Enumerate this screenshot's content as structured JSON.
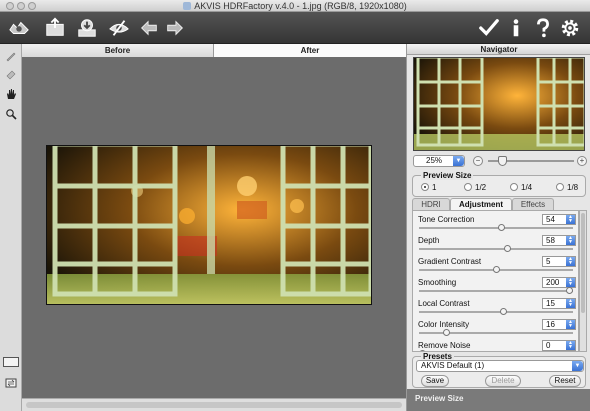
{
  "window": {
    "title": "AKVIS HDRFactory v.4.0 - 1.jpg (RGB/8, 1920x1080)"
  },
  "toolbar": {
    "left_icons": [
      "hdrfactory-logo-icon",
      "open-image-icon",
      "save-image-icon",
      "preview-eye-icon",
      "undo-arrow-icon",
      "redo-arrow-icon"
    ],
    "right_icons": [
      "apply-check-icon",
      "info-icon",
      "help-icon",
      "settings-gear-icon"
    ]
  },
  "left_tools": [
    "brush-icon",
    "eraser-icon",
    "hand-icon",
    "zoom-icon"
  ],
  "view_tabs": {
    "before": "Before",
    "after": "After"
  },
  "navigator": {
    "title": "Navigator",
    "zoom": "25%"
  },
  "preview_size": {
    "title": "Preview Size",
    "options": [
      "1",
      "1/2",
      "1/4",
      "1/8"
    ],
    "selected": "1"
  },
  "tabs": {
    "hdri": "HDRI",
    "adjustment": "Adjustment",
    "effects": "Effects",
    "active": "Adjustment"
  },
  "params": [
    {
      "label": "Tone Correction",
      "value": "54",
      "level": 0.54
    },
    {
      "label": "Depth",
      "value": "58",
      "level": 0.58
    },
    {
      "label": "Gradient Contrast",
      "value": "5",
      "level": 0.5
    },
    {
      "label": "Smoothing",
      "value": "200",
      "level": 1.0
    },
    {
      "label": "Local Contrast",
      "value": "15",
      "level": 0.55
    },
    {
      "label": "Color Intensity",
      "value": "16",
      "level": 0.16
    },
    {
      "label": "Remove Noise",
      "value": "0",
      "level": 0.0
    }
  ],
  "presets": {
    "title": "Presets",
    "selected": "AKVIS Default (1)",
    "save": "Save",
    "delete": "Delete",
    "reset": "Reset"
  },
  "help_panel": {
    "title": "Preview Size"
  },
  "colors": {
    "toolbar": "#3d3d3d",
    "canvas": "#6c6c6c",
    "panel": "#e6e6e6",
    "accent": "#3a72d4"
  }
}
